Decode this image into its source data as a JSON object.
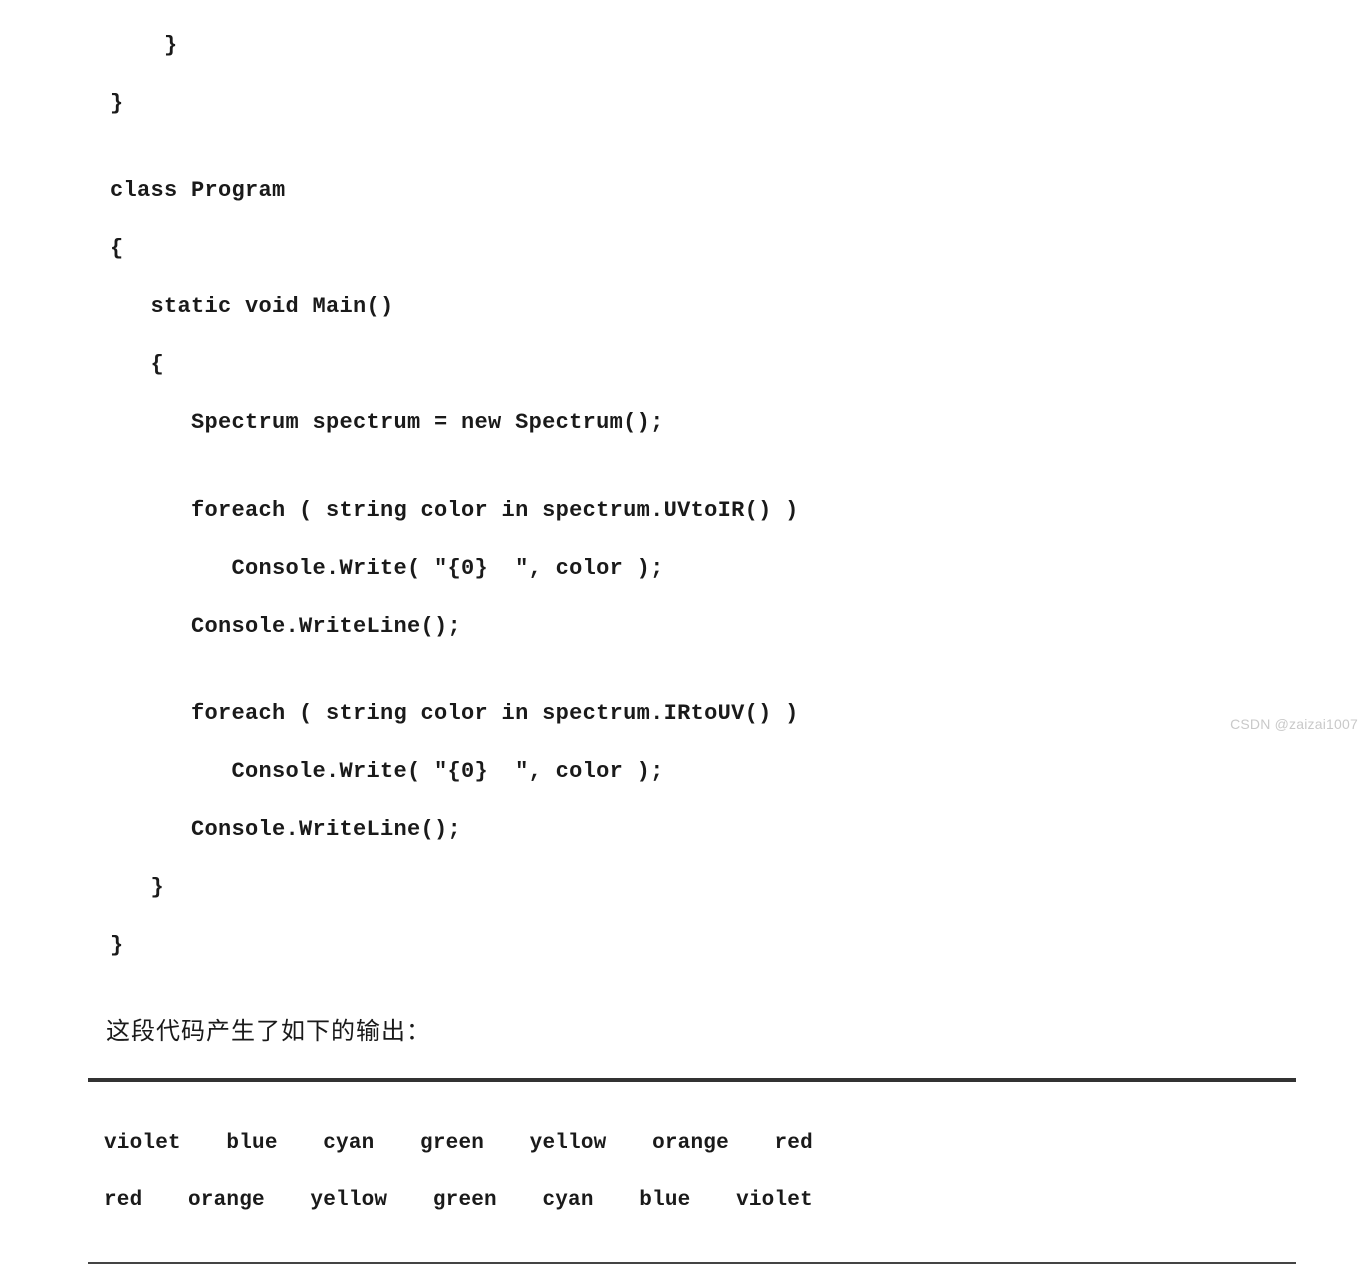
{
  "code": {
    "line1": "    }",
    "line2": "}",
    "line3": "",
    "line4": "class Program",
    "line5": "{",
    "line6": "   static void Main()",
    "line7": "   {",
    "line8": "      Spectrum spectrum = new Spectrum();",
    "line9": "",
    "line10": "      foreach ( string color in spectrum.UVtoIR() )",
    "line11": "         Console.Write( \"{0}  \", color );",
    "line12": "      Console.WriteLine();",
    "line13": "",
    "line14": "      foreach ( string color in spectrum.IRtoUV() )",
    "line15": "         Console.Write( \"{0}  \", color );",
    "line16": "      Console.WriteLine();",
    "line17": "   }",
    "line18": "}"
  },
  "description": "这段代码产生了如下的输出：",
  "output": {
    "line1": "violet  blue  cyan  green  yellow  orange  red",
    "line2": "red  orange  yellow  green  cyan  blue  violet"
  },
  "watermark": "CSDN @zaizai1007"
}
